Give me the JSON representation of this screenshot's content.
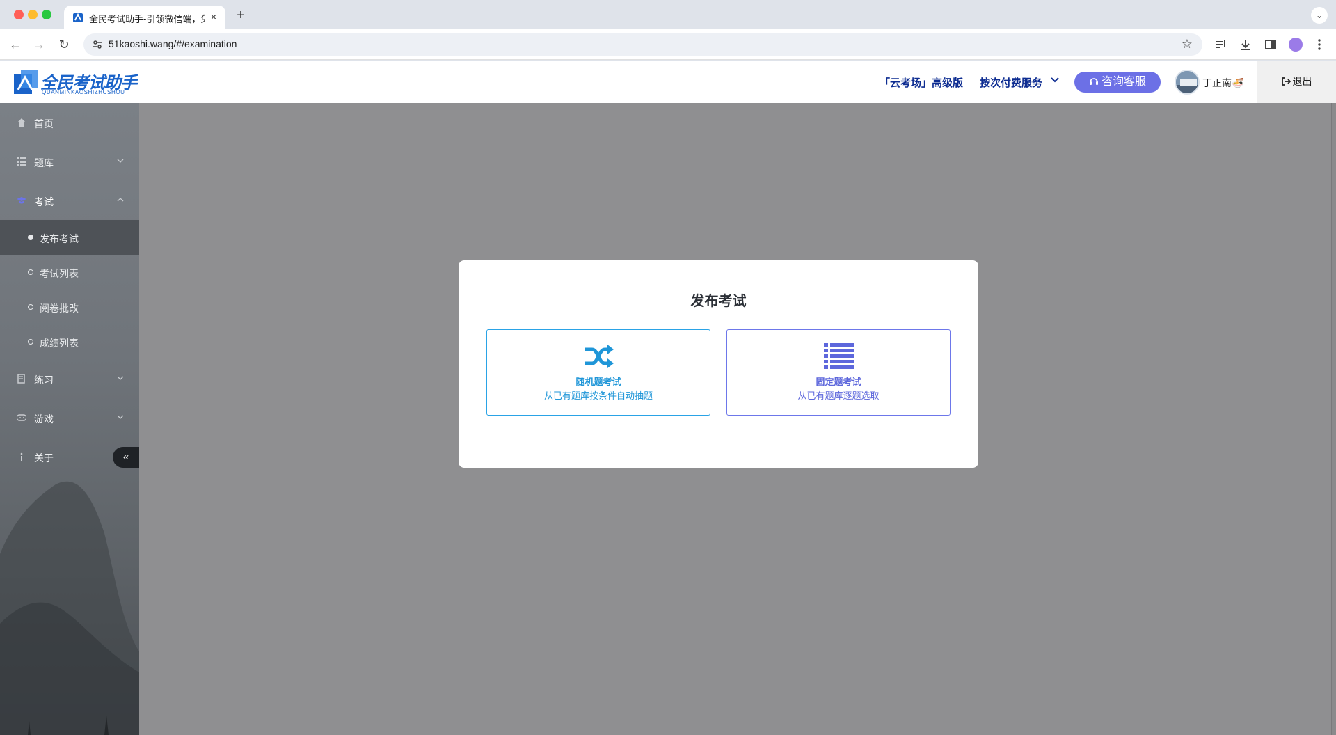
{
  "browser": {
    "tab_title": "全民考试助手-引领微信端，免费",
    "tab_close": "×",
    "new_tab": "+",
    "tab_menu": "⌄",
    "url": "51kaoshi.wang/#/examination",
    "back": "←",
    "forward": "→",
    "reload": "↻",
    "star": "☆",
    "toolbar_icons": [
      "reading-list-icon",
      "download-icon",
      "side-panel-icon",
      "profile-icon",
      "menu-icon"
    ]
  },
  "header": {
    "logo_title": "全民考试助手",
    "logo_subtitle": "QUANMINKAOSHIZHUSHOU",
    "cloud_link": "「云考场」高级版",
    "pay_service": "按次付费服务",
    "consult_button": "咨询客服",
    "username": "丁正南🍜",
    "logout": "退出"
  },
  "sidebar": {
    "items": [
      {
        "label": "首页",
        "icon": "home-icon"
      },
      {
        "label": "题库",
        "icon": "grid-icon"
      },
      {
        "label": "考试",
        "icon": "graduation-cap-icon"
      },
      {
        "label": "练习",
        "icon": "book-icon"
      },
      {
        "label": "游戏",
        "icon": "gamepad-icon"
      },
      {
        "label": "关于",
        "icon": "info-icon"
      }
    ],
    "exam_sub_items": [
      "发布考试",
      "考试列表",
      "阅卷批改",
      "成绩列表"
    ],
    "collapse_label": "«"
  },
  "modal": {
    "title": "发布考试",
    "options": [
      {
        "name": "随机题考试",
        "desc": "从已有题库按条件自动抽题",
        "icon": "shuffle-icon"
      },
      {
        "name": "固定题考试",
        "desc": "从已有题库逐题选取",
        "icon": "list-icon"
      }
    ]
  },
  "colors": {
    "brand_blue": "#1a63c9",
    "header_link": "#0d2c91",
    "consult_button": "#6c70e6",
    "random_option": "#1f96d8",
    "fixed_option": "#5d67dc",
    "overlay": "#8f8f91"
  }
}
